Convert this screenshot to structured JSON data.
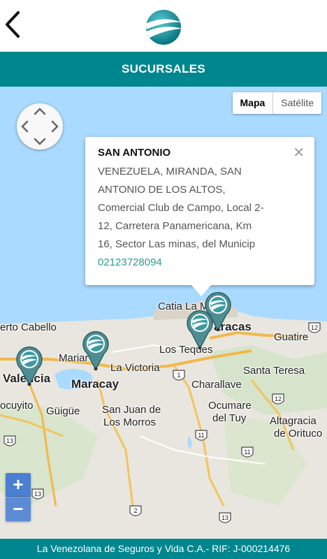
{
  "header": {
    "back_icon": "chevron-left-icon",
    "logo": "insurer-globe-logo"
  },
  "title": "SUCURSALES",
  "map_type": {
    "map": "Mapa",
    "satellite": "Satélite"
  },
  "zoom": {
    "in": "+",
    "out": "−"
  },
  "info_window": {
    "title": "SAN ANTONIO",
    "lines": [
      "VENEZUELA, MIRANDA, SAN",
      "ANTONIO DE LOS ALTOS,",
      "Comercial Club de Campo, Local 2-",
      "12, Carretera Panamericana, Km",
      "16, Sector Las minas, del Municip"
    ],
    "phone": "02123728094",
    "close": "✕"
  },
  "map_labels": {
    "puerto_cabello": "erto Cabello",
    "catia": "Catia La M",
    "caracas": "aracas",
    "guatire": "Guatire",
    "mariara": "Mariar",
    "la_victoria": "La Victoria",
    "los_teques": "Los Teques",
    "santa_teresa": "Santa Teresa",
    "valencia": "Valencia",
    "maracay": "Maracay",
    "charallave": "Charallave",
    "tocuyito": "ocuyito",
    "guigue": "Güigüe",
    "san_juan": "San Juan de",
    "los_morros": "Los Morros",
    "ocumare1": "Ocumare",
    "ocumare2": "del Tuy",
    "altagracia1": "Altagracia",
    "altagracia2": "de Orituco"
  },
  "road_shields": [
    "1",
    "12",
    "11",
    "11",
    "12",
    "13",
    "2",
    "13",
    "13"
  ],
  "footer": "La Venezolana de Seguros y Vida C.A.- RIF: J-000214476",
  "colors": {
    "brand": "#00868f",
    "sea": "#aadaff",
    "land": "#e8e6df",
    "pin": "#4f8d92"
  }
}
